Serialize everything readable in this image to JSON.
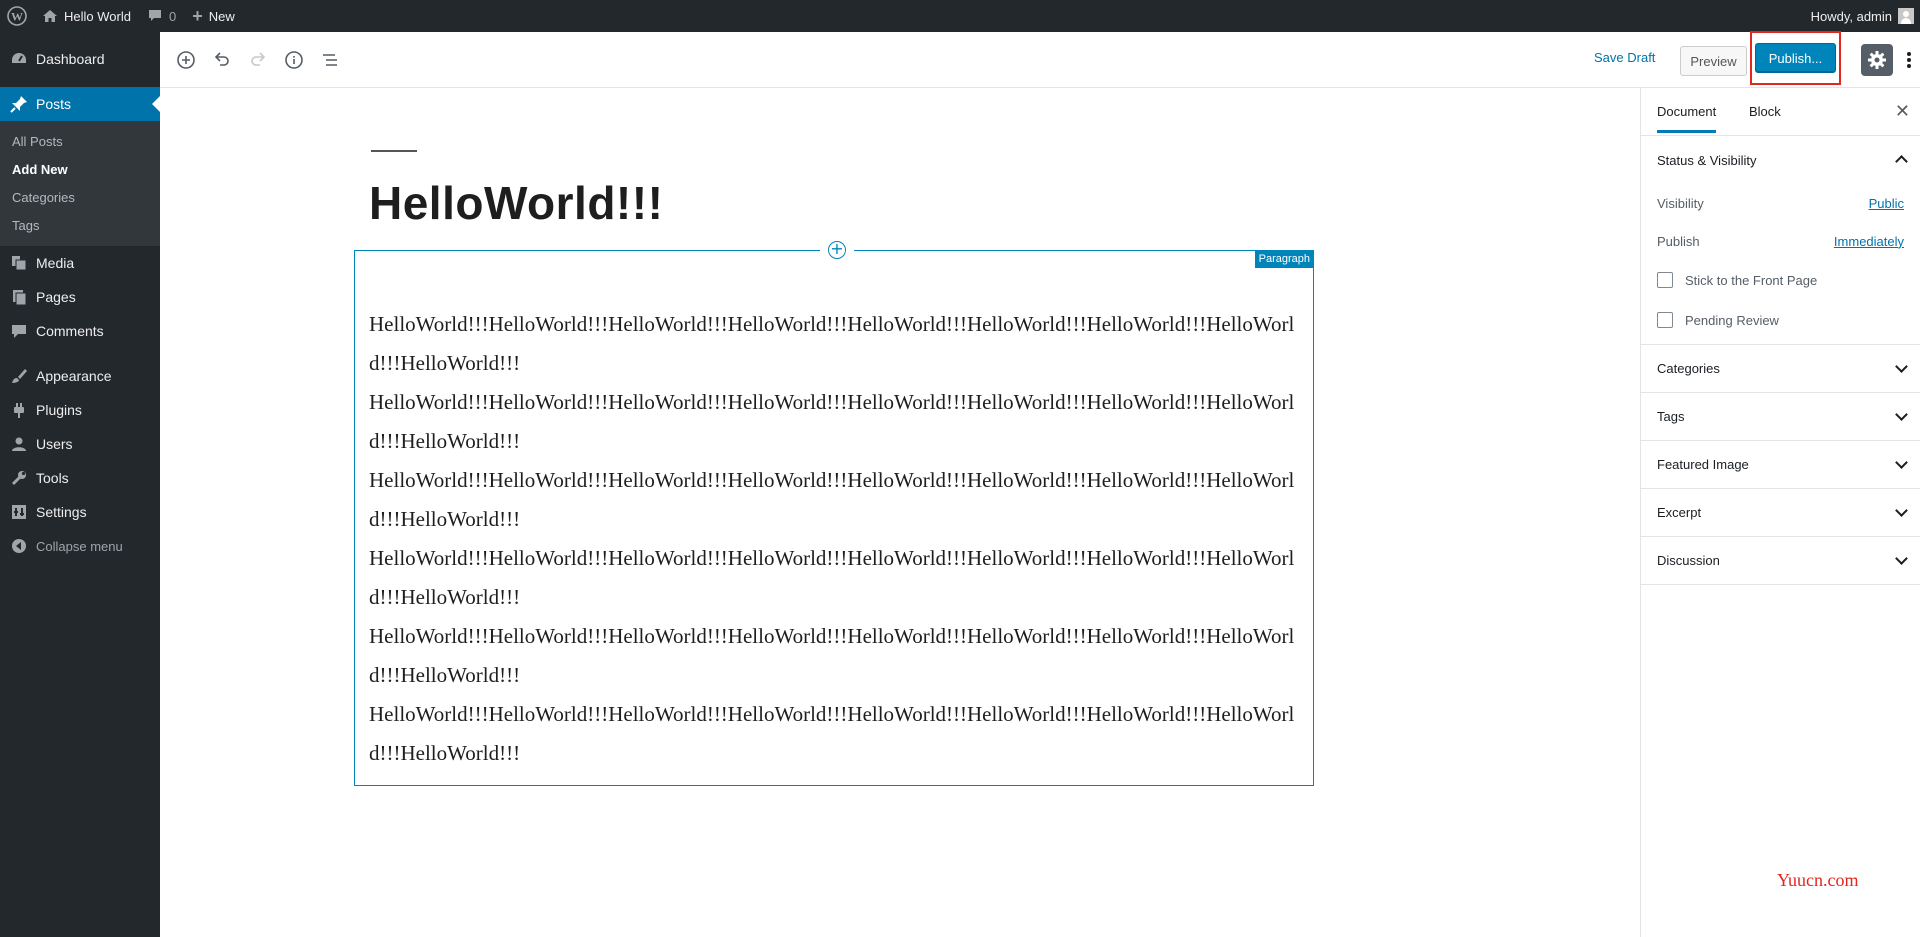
{
  "admin_bar": {
    "site_name": "Hello World",
    "comments_count": "0",
    "new_label": "New",
    "howdy": "Howdy, admin"
  },
  "admin_menu": {
    "items": [
      {
        "label": "Dashboard",
        "icon": "dashboard-icon"
      },
      {
        "label": "Posts",
        "icon": "pin-icon"
      },
      {
        "label": "Media",
        "icon": "media-icon"
      },
      {
        "label": "Pages",
        "icon": "pages-icon"
      },
      {
        "label": "Comments",
        "icon": "comment-icon"
      },
      {
        "label": "Appearance",
        "icon": "brush-icon"
      },
      {
        "label": "Plugins",
        "icon": "plug-icon"
      },
      {
        "label": "Users",
        "icon": "user-icon"
      },
      {
        "label": "Tools",
        "icon": "wrench-icon"
      },
      {
        "label": "Settings",
        "icon": "settings-icon"
      }
    ],
    "posts_submenu": [
      "All Posts",
      "Add New",
      "Categories",
      "Tags"
    ],
    "collapse_label": "Collapse menu"
  },
  "toolbar": {
    "save_draft": "Save Draft",
    "preview": "Preview",
    "publish": "Publish..."
  },
  "editor": {
    "title": "HelloWorld!!!",
    "block_label": "Paragraph",
    "paragraphs": [
      "HelloWorld!!!HelloWorld!!!HelloWorld!!!HelloWorld!!!HelloWorld!!!HelloWorld!!!HelloWorld!!!HelloWorld!!!HelloWorld!!!",
      "HelloWorld!!!HelloWorld!!!HelloWorld!!!HelloWorld!!!HelloWorld!!!HelloWorld!!!HelloWorld!!!HelloWorld!!!HelloWorld!!!",
      "HelloWorld!!!HelloWorld!!!HelloWorld!!!HelloWorld!!!HelloWorld!!!HelloWorld!!!HelloWorld!!!HelloWorld!!!HelloWorld!!!",
      "HelloWorld!!!HelloWorld!!!HelloWorld!!!HelloWorld!!!HelloWorld!!!HelloWorld!!!HelloWorld!!!HelloWorld!!!HelloWorld!!!",
      "HelloWorld!!!HelloWorld!!!HelloWorld!!!HelloWorld!!!HelloWorld!!!HelloWorld!!!HelloWorld!!!HelloWorld!!!HelloWorld!!!",
      "HelloWorld!!!HelloWorld!!!HelloWorld!!!HelloWorld!!!HelloWorld!!!HelloWorld!!!HelloWorld!!!HelloWorld!!!HelloWorld!!!"
    ]
  },
  "sidebar": {
    "tab_document": "Document",
    "tab_block": "Block",
    "status_title": "Status & Visibility",
    "visibility_label": "Visibility",
    "visibility_value": "Public",
    "publish_label": "Publish",
    "publish_value": "Immediately",
    "stick_label": "Stick to the Front Page",
    "pending_label": "Pending Review",
    "panels": [
      "Categories",
      "Tags",
      "Featured Image",
      "Excerpt",
      "Discussion"
    ]
  },
  "watermark": "Yuucn.com",
  "colors": {
    "admin_dark": "#23282d",
    "accent": "#0073aa",
    "publish_blue": "#0085ba",
    "highlight_red": "#e0281f"
  }
}
